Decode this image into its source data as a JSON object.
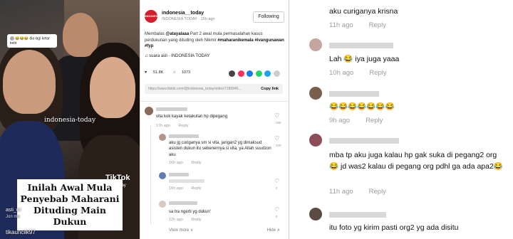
{
  "video": {
    "inset_comment": "😂😂😂 dia lagi ketar ketir",
    "watermark": "indonesia-today",
    "tiktok_logo": "TikTok",
    "tiktok_user": "@ia_today",
    "caption_lines": [
      "Inilah Awal Mula",
      "Penyebab Maharani",
      "Dituding  Main",
      "Dukun"
    ],
    "overlay_user_1": "asti_wi",
    "overlay_user_2": "Jon ma",
    "bottom_user": "tikauncilk97"
  },
  "post": {
    "brand_avatar_text": "INDONESIA TODAY",
    "brand_name": "indonesia__today",
    "brand_meta": "INDONESIA TODAY · 15h ago",
    "follow_label": "Following",
    "desc_prefix": "Membalas ",
    "desc_mention": "@atayalaaa",
    "desc_body": " Part 2 awal mula permasalahan kasus perdukunan yang dituding oleh Nikmir ",
    "desc_tags": "#maharanikemala #ivangunawan #fyp",
    "sound": "♫  suara asli - INDONESIA TODAY",
    "likes": "51.8K",
    "comments": "1073",
    "link": "https://www.tiktok.com/@indonesia_today/video/7189946...",
    "copy_link": "Copy link",
    "comment_1_text": "vita kok kayak ketakutan hp dipegang",
    "comment_1_time": "17h ago",
    "comment_2_text": "aku jg curiganya sm si vita, jangan2 yg dimaksud asisten dukun itu sebenernya si vita, ya Allah suudzon aku",
    "comment_2_time": "16h ago",
    "comment_3_text": "",
    "comment_3_time": "16h ago",
    "comment_4_text": "sa tra ngerti yg dukun'",
    "comment_4_time": "12h ago",
    "reply_label": "Reply",
    "counts": [
      "265",
      "100",
      "2",
      "0"
    ],
    "view_more": "View more  ∨",
    "hide": "Hide  ∧"
  },
  "right_comments": {
    "reply_label": "Reply",
    "c1_text": "aku curiganya krisna",
    "c1_time": "11h ago",
    "c2_text": "Lah 😂 iya juga yaaa",
    "c2_time": "10h ago",
    "c3_text": "😂😂😂😂😂😂😂",
    "c3_time": "9h ago",
    "c4_text": "mba tp aku juga kalau hp gak suka di pegang2 org 😂 jd was2 kalau di pegang org pdhl ga ada apa2😂",
    "c4_time": "11h ago",
    "c5_text": "itu foto yg kirim pasti org2 yg ada disitu"
  }
}
